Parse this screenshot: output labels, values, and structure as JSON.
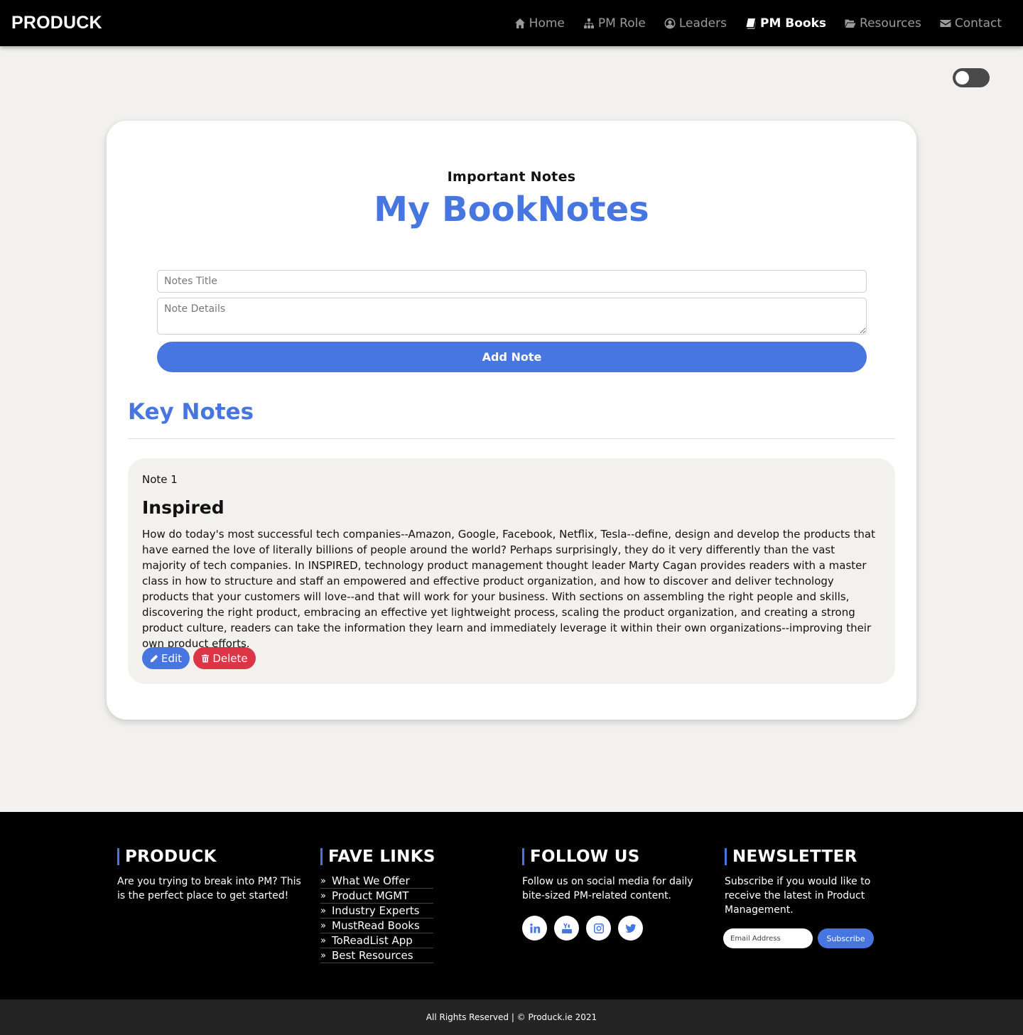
{
  "nav": {
    "brand": "PRODUCK",
    "items": [
      {
        "label": "Home",
        "icon": "home-icon"
      },
      {
        "label": "PM Role",
        "icon": "sitemap-icon"
      },
      {
        "label": "Leaders",
        "icon": "user-circle-icon"
      },
      {
        "label": "PM Books",
        "icon": "book-icon",
        "active": true
      },
      {
        "label": "Resources",
        "icon": "folder-open-icon"
      },
      {
        "label": "Contact",
        "icon": "envelope-icon"
      }
    ]
  },
  "theme_toggle": {
    "state": "off"
  },
  "card": {
    "subtitle": "Important Notes",
    "title": "My BookNotes",
    "form": {
      "title_placeholder": "Notes Title",
      "details_placeholder": "Note Details",
      "add_label": "Add Note"
    },
    "section_title": "Key Notes",
    "notes": [
      {
        "number": "Note 1",
        "title": "Inspired",
        "body": "How do today's most successful tech companies--Amazon, Google, Facebook, Netflix, Tesla--define, design and develop the products that have earned the love of literally billions of people around the world? Perhaps surprisingly, they do it very differently than the vast majority of tech companies. In INSPIRED, technology product management thought leader Marty Cagan provides readers with a master class in how to structure and staff an empowered and effective product organization, and how to discover and deliver technology products that your customers will love--and that will work for your business. With sections on assembling the right people and skills, discovering the right product, embracing an effective yet lightweight process, scaling the product organization, and creating a strong product culture, readers can take the information they learn and immediately leverage it within their own organizations--improving their own product efforts.",
        "edit_label": "Edit",
        "delete_label": "Delete"
      }
    ]
  },
  "footer": {
    "about": {
      "heading": "PRODUCK",
      "text": "Are you trying to break into PM? This is the perfect place to get started!"
    },
    "links": {
      "heading": "FAVE LINKS",
      "items": [
        "What We Offer",
        "Product MGMT",
        "Industry Experts",
        "MustRead Books",
        "ToReadList App",
        "Best Resources"
      ],
      "bullet": "»"
    },
    "follow": {
      "heading": "FOLLOW US",
      "text": "Follow us on social media for daily bite-sized PM-related content.",
      "icons": [
        "linkedin-icon",
        "youtube-icon",
        "instagram-icon",
        "twitter-icon"
      ]
    },
    "newsletter": {
      "heading": "NEWSLETTER",
      "text": "Subscribe if you would like to receive the latest in Product Management.",
      "email_placeholder": "Email Address",
      "subscribe_label": "Subscribe"
    },
    "copyright": "All Rights Reserved | © Produck.ie 2021"
  },
  "colors": {
    "accent": "#4876e0",
    "danger": "#dc3545",
    "nav_bg": "#000000",
    "page_bg": "#f2f1ee"
  }
}
